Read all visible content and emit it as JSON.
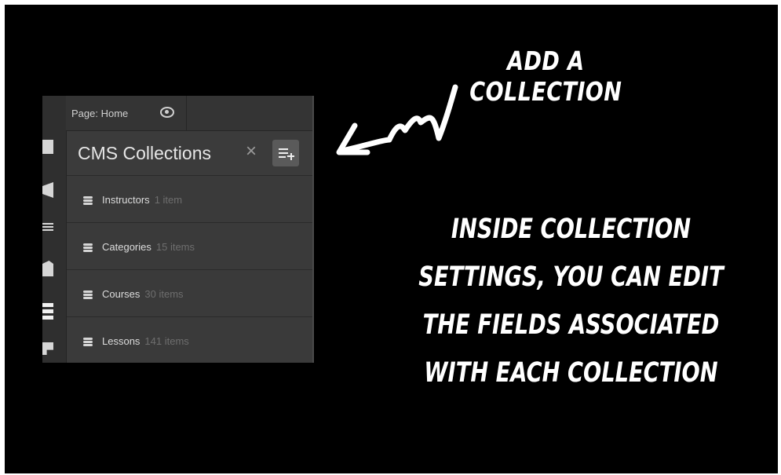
{
  "top_bar": {
    "page_label": "Page: Home"
  },
  "cms_panel": {
    "title": "CMS Collections",
    "close_symbol": "×",
    "collections": [
      {
        "name": "Instructors",
        "count": "1 item"
      },
      {
        "name": "Categories",
        "count": "15 items"
      },
      {
        "name": "Courses",
        "count": "30 items"
      },
      {
        "name": "Lessons",
        "count": "141 items"
      }
    ]
  },
  "annotations": {
    "add_collection": "ADD A COLLECTION",
    "description": "INSIDE COLLECTION SETTINGS, YOU CAN EDIT THE FIELDS ASSOCIATED WITH EACH COLLECTION"
  },
  "icons": {
    "rail": [
      "add-panel-icon",
      "box-icon",
      "navigator-icon",
      "pages-icon",
      "cms-icon",
      "assets-icon"
    ],
    "top": [
      "eye-icon"
    ],
    "panel": [
      "close-icon",
      "add-collection-icon",
      "database-icon"
    ],
    "annotation": [
      "squiggle-arrow-icon"
    ]
  },
  "colors": {
    "background": "#000000",
    "panel": "#3a3a3a",
    "text": "#ffffff"
  }
}
